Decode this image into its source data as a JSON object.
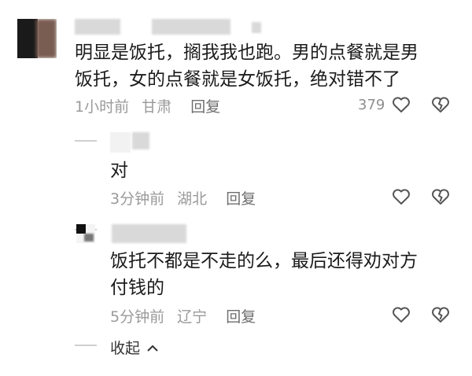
{
  "comments": [
    {
      "text_line1": "明显是饭托，搁我我也跑。男的点餐就是男",
      "text_line2": "饭托，女的点餐就是女饭托，绝对错不了",
      "time": "1小时前",
      "location": "甘肃",
      "reply_label": "回复",
      "like_count": "379"
    },
    {
      "text_line1": "对",
      "time": "3分钟前",
      "location": "湖北",
      "reply_label": "回复"
    },
    {
      "text_line1": "饭托不都是不走的么，最后还得劝对方",
      "text_line2": "付钱的",
      "time": "5分钟前",
      "location": "辽宁",
      "reply_label": "回复"
    }
  ],
  "collapse_label": "收起",
  "icons": {
    "like": "heart-outline-icon",
    "dislike": "broken-heart-icon",
    "collapse": "chevron-up-icon"
  },
  "colors": {
    "text": "#1b1b1b",
    "meta": "#9a9a9a",
    "reply": "#6e6e6e"
  }
}
